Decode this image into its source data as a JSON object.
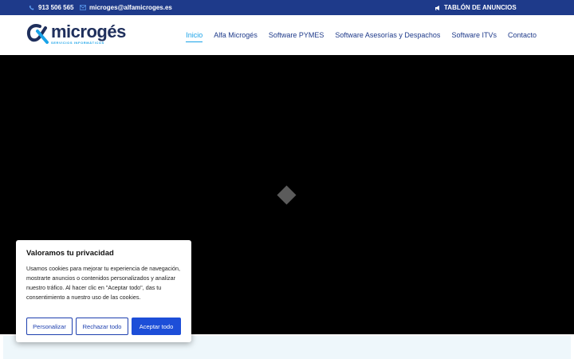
{
  "topbar": {
    "phone": "913 506 565",
    "email": "microges@alfamicroges.es",
    "announcements": "TABLÓN DE ANUNCIOS"
  },
  "logo": {
    "name": "microgés",
    "subtitle": "SERVICIOS INFORMÁTICOS"
  },
  "nav": {
    "items": [
      "Inicio",
      "Alfa Microgés",
      "Software PYMES",
      "Software Asesorías y Despachos",
      "Software ITVs",
      "Contacto"
    ],
    "active_index": 0
  },
  "cookie": {
    "title": "Valoramos tu privacidad",
    "text": "Usamos cookies para mejorar tu experiencia de navegación, mostrarte anuncios o contenidos personalizados y analizar nuestro tráfico. Al hacer clic en \"Aceptar todo\", das tu consentimiento a nuestro uso de las cookies.",
    "customize_label": "Personalizar",
    "reject_label": "Rechazar todo",
    "accept_label": "Aceptar todo"
  },
  "colors": {
    "topbar_bg": "#1e3a8a",
    "accent": "#1aa3e8",
    "nav_text": "#1e3a8a",
    "button_primary": "#1d4ed8"
  },
  "icons": {
    "phone": "phone-icon",
    "email": "envelope-icon",
    "announcements": "megaphone-icon"
  }
}
